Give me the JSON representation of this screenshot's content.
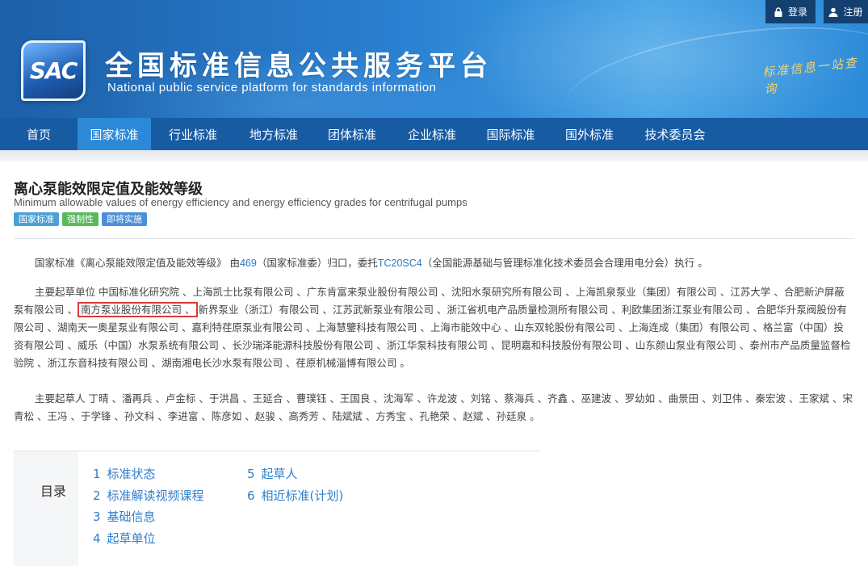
{
  "header": {
    "logo_text": "SAC",
    "title": "全国标准信息公共服务平台",
    "subtitle": "National public service platform  for standards information",
    "slogan": "标准信息一站查询",
    "login_label": "登录",
    "register_label": "注册"
  },
  "nav": {
    "items": [
      "首页",
      "国家标准",
      "行业标准",
      "地方标准",
      "团体标准",
      "企业标准",
      "国际标准",
      "国外标准",
      "技术委员会"
    ],
    "active_index": 1
  },
  "standard": {
    "title_cn": "离心泵能效限定值及能效等级",
    "title_en": "Minimum allowable values of energy efficiency and energy efficiency grades for centrifugal pumps",
    "tags": [
      "国家标准",
      "强制性",
      "即将实施"
    ]
  },
  "para1": {
    "prefix": "国家标准《离心泵能效限定值及能效等级》 由",
    "tc_num": "469",
    "middle": "（国家标准委）归口，委托",
    "tc_code": "TC20SC4",
    "suffix": "（全国能源基础与管理标准化技术委员会合理用电分会）执行 。"
  },
  "para2": {
    "before": "主要起草单位 中国标准化研究院 、上海凯士比泵有限公司 、广东肯富来泵业股份有限公司 、沈阳水泵研究所有限公司 、上海凯泉泵业（集团）有限公司 、江苏大学 、合肥新沪屏蔽泵有限公司 、",
    "highlight": "南方泵业股份有限公司 、",
    "after": "新界泵业（浙江）有限公司 、江苏武新泵业有限公司 、浙江省机电产品质量检测所有限公司 、利欧集团浙江泵业有限公司 、合肥华升泵阀股份有限公司 、湖南天一奥星泵业有限公司 、嘉利特荏原泵业有限公司 、上海慧鑒科技有限公司 、上海市能效中心 、山东双轮股份有限公司 、上海连成（集团）有限公司 、格兰富（中国）投资有限公司 、威乐（中国）水泵系统有限公司 、长沙瑞泽能源科技股份有限公司 、浙江华泵科技有限公司 、昆明嘉和科技股份有限公司 、山东颜山泵业有限公司 、泰州市产品质量监督检验院 、浙江东音科技有限公司 、湖南湘电长沙水泵有限公司 、荏原机械淄博有限公司 。"
  },
  "para3": {
    "text": "主要起草人 丁晴 、潘再兵 、卢金标 、于洪昌 、王延合 、曹璞钰 、王国良 、沈海军 、许龙波 、刘铭 、蔡海兵 、齐鑫 、巫建波 、罗幼如 、曲景田 、刘卫伟 、秦宏波 、王家斌 、宋青松 、王冯 、于学锋 、孙文科 、李进富 、陈彦如 、赵骏 、高秀芳 、陆斌斌 、方秀宝 、孔艳荣 、赵斌 、孙廷泉 。"
  },
  "toc": {
    "label": "目录",
    "col1": [
      {
        "num": "1",
        "label": "标准状态"
      },
      {
        "num": "2",
        "label": "标准解读视频课程"
      },
      {
        "num": "3",
        "label": "基础信息"
      },
      {
        "num": "4",
        "label": "起草单位"
      }
    ],
    "col2": [
      {
        "num": "5",
        "label": "起草人"
      },
      {
        "num": "6",
        "label": "相近标准(计划)"
      }
    ]
  }
}
